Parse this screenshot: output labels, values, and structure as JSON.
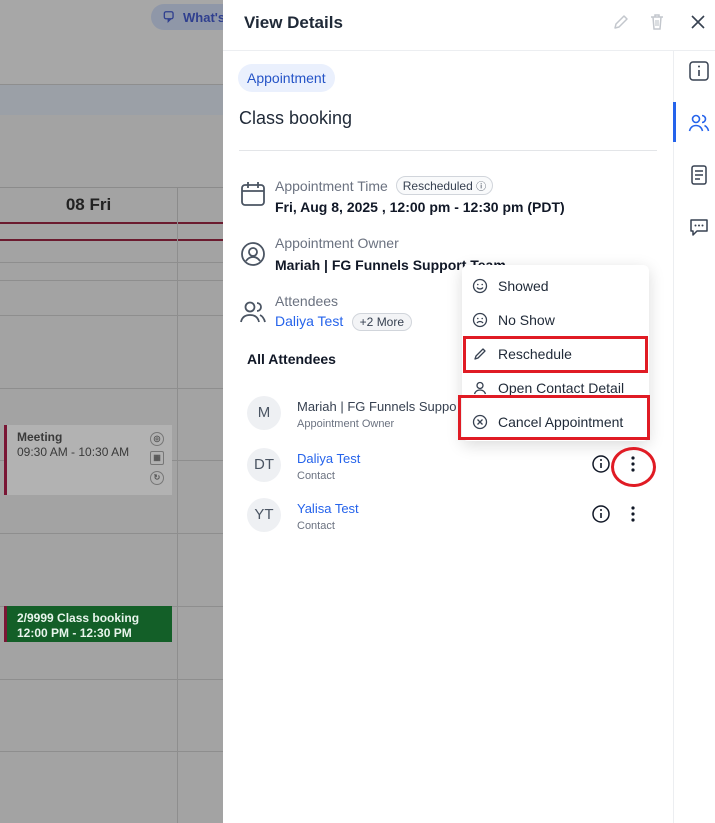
{
  "background": {
    "whats_new": "What's",
    "day_header": "08 Fri",
    "events": [
      {
        "title": "Meeting",
        "time": "09:30 AM - 10:30 AM"
      },
      {
        "title": "2/9999  Class booking",
        "time": "12:00 PM - 12:30 PM"
      }
    ]
  },
  "panel": {
    "title": "View Details",
    "type_pill": "Appointment",
    "name": "Class booking",
    "time_label": "Appointment Time",
    "status_badge": "Rescheduled",
    "time_value": "Fri, Aug 8, 2025 , 12:00 pm - 12:30 pm (PDT)",
    "owner_label": "Appointment Owner",
    "owner_value": "Mariah | FG Funnels Support Team",
    "attendees_label": "Attendees",
    "attendee_link": "Daliya Test",
    "more_badge": "+2 More",
    "all_attendees": "All Attendees",
    "attendees": [
      {
        "initials": "M",
        "name": "Mariah | FG Funnels Suppo",
        "role": "Appointment Owner"
      },
      {
        "initials": "DT",
        "name": "Daliya Test",
        "role": "Contact"
      },
      {
        "initials": "YT",
        "name": "Yalisa Test",
        "role": "Contact"
      }
    ]
  },
  "menu": {
    "items": [
      "Showed",
      "No Show",
      "Reschedule",
      "Open Contact Detail",
      "Cancel Appointment"
    ]
  },
  "colors": {
    "accent": "#2563eb",
    "highlight": "#e01b24",
    "event_green": "#135f28"
  }
}
